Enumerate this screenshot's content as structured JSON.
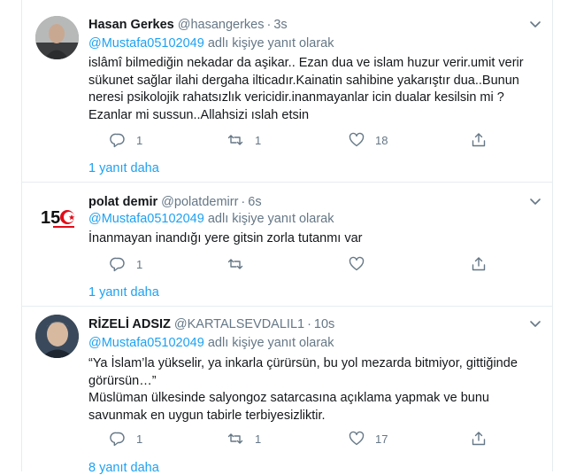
{
  "tweets": [
    {
      "name": "Hasan Gerkes",
      "handle": "@hasangerkes",
      "dot": "·",
      "time": "3s",
      "reply_prefix": "@Mustafa05102049",
      "reply_suffix": " adlı kişiye yanıt olarak",
      "lines": [
        "islâmî bilmediğin nekadar da aşikar.. Ezan dua ve islam huzur verir.umit verir",
        "sükunet sağlar ilahi dergaha ilticadır.Kainatin sahibine yakarıştır dua..Bunun",
        "neresi psikolojik rahatsızlık vericidir.inanmayanlar  icin dualar kesilsin  mi ?",
        "Ezanlar mi sussun..Allahsizi ıslah etsin"
      ],
      "replies": "1",
      "retweets": "1",
      "likes": "18",
      "more": "1 yanıt daha"
    },
    {
      "name": "polat demir",
      "handle": "@polatdemirr",
      "dot": "·",
      "time": "6s",
      "reply_prefix": "@Mustafa05102049",
      "reply_suffix": " adlı kişiye yanıt olarak",
      "lines": [
        "İnanmayan inandığı yere gitsin zorla tutanmı var"
      ],
      "replies": "1",
      "retweets": "",
      "likes": "",
      "more": "1 yanıt daha"
    },
    {
      "name": "RİZELİ ADSIZ",
      "handle": "@KARTALSEVDALIL1",
      "dot": "·",
      "time": "10s",
      "reply_prefix": "@Mustafa05102049",
      "reply_suffix": " adlı kişiye yanıt olarak",
      "lines": [
        "“Ya İslam’la yükselir, ya inkarla çürürsün, bu yol mezarda bitmiyor, gittiğinde",
        "görürsün…”",
        "Müslüman ülkesinde salyongoz satarcasına açıklama yapmak ve bunu",
        "savunmak en uygun tabirle terbiyesizliktir."
      ],
      "replies": "1",
      "retweets": "1",
      "likes": "17",
      "more": "8 yanıt daha"
    }
  ],
  "avatar2_text": "15",
  "colors": {
    "link": "#1da1f2",
    "muted": "#657786",
    "border": "#e6ecf0",
    "text": "#14171a"
  },
  "icons": [
    "caret-down-icon",
    "reply-icon",
    "retweet-icon",
    "like-icon",
    "share-icon"
  ]
}
